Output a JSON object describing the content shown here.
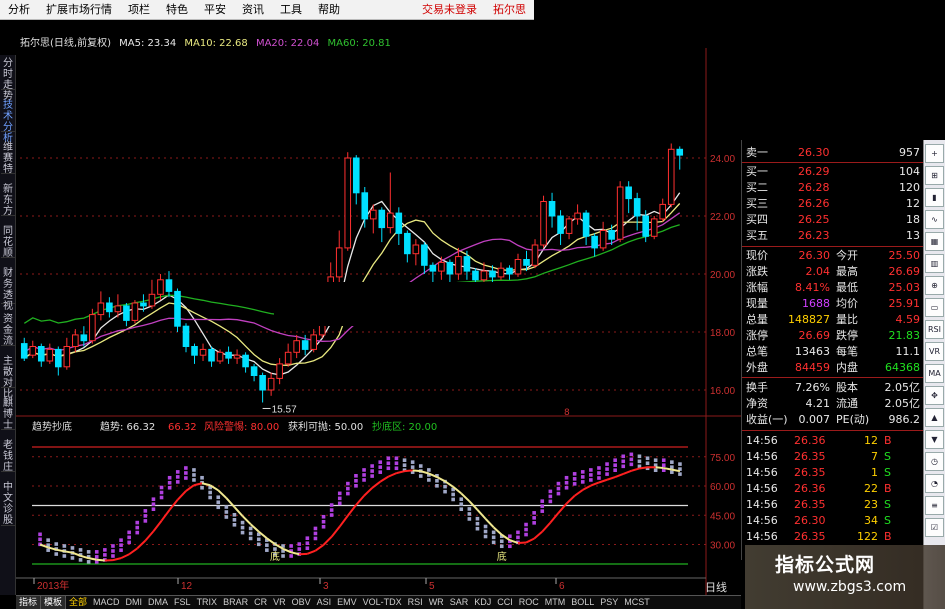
{
  "menu": {
    "items": [
      "分析",
      "扩展市场行情",
      "项栏",
      "特色",
      "平安",
      "资讯",
      "工具",
      "帮助"
    ],
    "login_status": "交易未登录",
    "stock_label": "拓尔思"
  },
  "title": {
    "stock": "拓尔思(日线,前复权)",
    "ma5": "MA5: 23.34",
    "ma10": "MA10: 22.68",
    "ma20": "MA20: 22.04",
    "ma60": "MA60: 20.81"
  },
  "left_tabs": [
    "分时走势",
    "技术分析",
    "维赛特",
    "新东方",
    "同花顺",
    "财务透视",
    "资金流",
    "主散对比",
    "麒博士",
    "老钱庄",
    "中文诊股"
  ],
  "colors": {
    "up": "#ff3030",
    "down": "#00e0ff",
    "ma5": "#e8e8e8",
    "ma10": "#e8e880",
    "ma20": "#c040c0",
    "ma60": "#20b020",
    "grid": "#8b1a1a"
  },
  "chart_data": {
    "type": "candlestick",
    "price_axis": [
      "24.00",
      "22.00",
      "20.00",
      "18.00",
      "16.00"
    ],
    "low_annotation": "15.57",
    "x_labels": [
      "2013年",
      "12",
      "3",
      "5",
      "6"
    ],
    "candles": [
      {
        "o": 17.6,
        "c": 17.1,
        "h": 17.8,
        "l": 17.0
      },
      {
        "o": 17.2,
        "c": 17.5,
        "h": 17.7,
        "l": 17.1
      },
      {
        "o": 17.5,
        "c": 17.0,
        "h": 17.6,
        "l": 16.8
      },
      {
        "o": 17.0,
        "c": 17.4,
        "h": 17.6,
        "l": 16.9
      },
      {
        "o": 17.4,
        "c": 16.8,
        "h": 17.5,
        "l": 16.5
      },
      {
        "o": 16.8,
        "c": 17.5,
        "h": 17.8,
        "l": 16.7
      },
      {
        "o": 17.5,
        "c": 17.9,
        "h": 18.1,
        "l": 17.3
      },
      {
        "o": 17.9,
        "c": 17.7,
        "h": 18.2,
        "l": 17.5
      },
      {
        "o": 17.7,
        "c": 18.6,
        "h": 18.8,
        "l": 17.6
      },
      {
        "o": 18.6,
        "c": 19.0,
        "h": 19.4,
        "l": 18.4
      },
      {
        "o": 19.0,
        "c": 18.7,
        "h": 19.2,
        "l": 18.5
      },
      {
        "o": 18.7,
        "c": 18.9,
        "h": 19.3,
        "l": 18.5
      },
      {
        "o": 18.9,
        "c": 18.4,
        "h": 19.0,
        "l": 18.2
      },
      {
        "o": 18.4,
        "c": 19.0,
        "h": 19.1,
        "l": 18.3
      },
      {
        "o": 19.0,
        "c": 18.9,
        "h": 19.3,
        "l": 18.7
      },
      {
        "o": 18.9,
        "c": 19.3,
        "h": 19.8,
        "l": 18.8
      },
      {
        "o": 19.3,
        "c": 19.8,
        "h": 20.0,
        "l": 19.1
      },
      {
        "o": 19.8,
        "c": 19.4,
        "h": 20.1,
        "l": 19.2
      },
      {
        "o": 19.4,
        "c": 18.2,
        "h": 19.5,
        "l": 18.0
      },
      {
        "o": 18.2,
        "c": 17.5,
        "h": 18.3,
        "l": 17.3
      },
      {
        "o": 17.5,
        "c": 17.2,
        "h": 17.6,
        "l": 16.9
      },
      {
        "o": 17.2,
        "c": 17.4,
        "h": 17.6,
        "l": 17.0
      },
      {
        "o": 17.4,
        "c": 17.0,
        "h": 17.5,
        "l": 16.8
      },
      {
        "o": 17.0,
        "c": 17.3,
        "h": 17.4,
        "l": 16.9
      },
      {
        "o": 17.3,
        "c": 17.1,
        "h": 17.5,
        "l": 16.9
      },
      {
        "o": 17.1,
        "c": 17.2,
        "h": 17.4,
        "l": 16.9
      },
      {
        "o": 17.2,
        "c": 16.8,
        "h": 17.3,
        "l": 16.6
      },
      {
        "o": 16.8,
        "c": 16.5,
        "h": 16.9,
        "l": 16.3
      },
      {
        "o": 16.5,
        "c": 16.0,
        "h": 16.6,
        "l": 15.57
      },
      {
        "o": 16.0,
        "c": 16.4,
        "h": 16.6,
        "l": 15.8
      },
      {
        "o": 16.4,
        "c": 16.9,
        "h": 17.1,
        "l": 16.2
      },
      {
        "o": 16.9,
        "c": 17.3,
        "h": 17.6,
        "l": 16.8
      },
      {
        "o": 17.3,
        "c": 17.7,
        "h": 17.9,
        "l": 17.1
      },
      {
        "o": 17.7,
        "c": 17.4,
        "h": 17.9,
        "l": 17.2
      },
      {
        "o": 17.4,
        "c": 17.9,
        "h": 18.1,
        "l": 17.3
      },
      {
        "o": 17.9,
        "c": 18.6,
        "h": 18.8,
        "l": 17.8
      },
      {
        "o": 18.6,
        "c": 19.9,
        "h": 20.4,
        "l": 18.5
      },
      {
        "o": 19.9,
        "c": 20.9,
        "h": 21.5,
        "l": 19.7
      },
      {
        "o": 20.9,
        "c": 24.0,
        "h": 24.2,
        "l": 20.8
      },
      {
        "o": 24.0,
        "c": 22.8,
        "h": 24.1,
        "l": 22.4
      },
      {
        "o": 22.8,
        "c": 21.9,
        "h": 23.0,
        "l": 21.6
      },
      {
        "o": 21.9,
        "c": 22.2,
        "h": 22.4,
        "l": 21.4
      },
      {
        "o": 22.2,
        "c": 21.6,
        "h": 22.3,
        "l": 21.1
      },
      {
        "o": 21.6,
        "c": 22.1,
        "h": 23.5,
        "l": 21.4
      },
      {
        "o": 22.1,
        "c": 21.4,
        "h": 22.3,
        "l": 21.0
      },
      {
        "o": 21.4,
        "c": 20.7,
        "h": 21.5,
        "l": 20.4
      },
      {
        "o": 20.7,
        "c": 21.0,
        "h": 21.2,
        "l": 20.3
      },
      {
        "o": 21.0,
        "c": 20.3,
        "h": 21.1,
        "l": 20.0
      },
      {
        "o": 20.3,
        "c": 20.1,
        "h": 20.4,
        "l": 19.7
      },
      {
        "o": 20.1,
        "c": 20.4,
        "h": 20.6,
        "l": 19.8
      },
      {
        "o": 20.4,
        "c": 20.0,
        "h": 20.5,
        "l": 19.6
      },
      {
        "o": 20.0,
        "c": 20.6,
        "h": 20.9,
        "l": 19.8
      },
      {
        "o": 20.6,
        "c": 20.1,
        "h": 20.8,
        "l": 19.8
      },
      {
        "o": 20.1,
        "c": 19.8,
        "h": 20.2,
        "l": 19.5
      },
      {
        "o": 19.8,
        "c": 20.1,
        "h": 20.4,
        "l": 19.6
      },
      {
        "o": 20.1,
        "c": 19.9,
        "h": 20.3,
        "l": 19.7
      },
      {
        "o": 19.9,
        "c": 20.2,
        "h": 20.4,
        "l": 19.8
      },
      {
        "o": 20.2,
        "c": 20.0,
        "h": 20.3,
        "l": 19.8
      },
      {
        "o": 20.0,
        "c": 20.5,
        "h": 20.7,
        "l": 19.9
      },
      {
        "o": 20.5,
        "c": 20.3,
        "h": 20.8,
        "l": 20.1
      },
      {
        "o": 20.3,
        "c": 21.0,
        "h": 21.2,
        "l": 20.2
      },
      {
        "o": 21.0,
        "c": 22.5,
        "h": 22.7,
        "l": 20.9
      },
      {
        "o": 22.5,
        "c": 22.0,
        "h": 22.8,
        "l": 21.6
      },
      {
        "o": 22.0,
        "c": 21.4,
        "h": 22.2,
        "l": 21.0
      },
      {
        "o": 21.4,
        "c": 21.9,
        "h": 22.0,
        "l": 21.2
      },
      {
        "o": 21.9,
        "c": 22.1,
        "h": 22.4,
        "l": 21.7
      },
      {
        "o": 22.1,
        "c": 21.3,
        "h": 22.2,
        "l": 21.0
      },
      {
        "o": 21.3,
        "c": 20.9,
        "h": 21.4,
        "l": 20.6
      },
      {
        "o": 20.9,
        "c": 21.5,
        "h": 21.8,
        "l": 20.8
      },
      {
        "o": 21.5,
        "c": 21.2,
        "h": 21.7,
        "l": 21.0
      },
      {
        "o": 21.2,
        "c": 23.0,
        "h": 23.2,
        "l": 21.1
      },
      {
        "o": 23.0,
        "c": 22.6,
        "h": 23.2,
        "l": 22.1
      },
      {
        "o": 22.6,
        "c": 22.0,
        "h": 22.8,
        "l": 21.5
      },
      {
        "o": 22.0,
        "c": 21.3,
        "h": 22.2,
        "l": 21.1
      },
      {
        "o": 21.3,
        "c": 21.9,
        "h": 22.0,
        "l": 21.2
      },
      {
        "o": 21.9,
        "c": 22.4,
        "h": 22.6,
        "l": 21.8
      },
      {
        "o": 22.4,
        "c": 24.3,
        "h": 24.5,
        "l": 22.3
      },
      {
        "o": 24.3,
        "c": 24.1,
        "h": 24.4,
        "l": 23.6
      }
    ],
    "lower_title": "趋势抄底",
    "trend_label": "趋势: 66.32",
    "trend_value": "66.32",
    "risk_label": "风险警惕: 80.00",
    "profit_label": "获利可抛: 50.00",
    "bottom_zone_label": "抄底区: 20.00",
    "lower_axis": [
      "75.00",
      "60.00",
      "45.00",
      "30.00"
    ],
    "bottom_marks": [
      "底",
      "底"
    ],
    "trend_series": [
      30,
      27,
      25,
      24,
      23,
      22,
      21,
      21,
      22,
      24,
      27,
      31,
      36,
      42,
      48,
      54,
      59,
      62,
      64,
      63,
      59,
      54,
      49,
      44,
      40,
      36,
      33,
      30,
      27,
      25,
      24,
      24,
      25,
      28,
      33,
      39,
      45,
      51,
      56,
      60,
      63,
      65,
      67,
      69,
      69,
      68,
      67,
      65,
      63,
      60,
      57,
      53,
      48,
      43,
      38,
      34,
      31,
      29,
      29,
      31,
      35,
      41,
      47,
      52,
      56,
      59,
      61,
      62,
      63,
      64,
      66,
      68,
      70,
      71,
      70,
      69,
      68,
      68,
      67,
      66
    ]
  },
  "quote": {
    "sell1": [
      "卖一",
      "26.30",
      "957"
    ],
    "buys": [
      [
        "买一",
        "26.29",
        "104"
      ],
      [
        "买二",
        "26.28",
        "120"
      ],
      [
        "买三",
        "26.26",
        "12"
      ],
      [
        "买四",
        "26.25",
        "18"
      ],
      [
        "买五",
        "26.23",
        "13"
      ]
    ],
    "stats": [
      [
        "现价",
        "26.30",
        "今开",
        "25.50"
      ],
      [
        "涨跌",
        "2.04",
        "最高",
        "26.69"
      ],
      [
        "涨幅",
        "8.41%",
        "最低",
        "25.03"
      ],
      [
        "现量",
        "1688",
        "均价",
        "25.91"
      ],
      [
        "总量",
        "148827",
        "量比",
        "4.59"
      ],
      [
        "涨停",
        "26.69",
        "跌停",
        "21.83"
      ],
      [
        "总笔",
        "13463",
        "每笔",
        "11.1"
      ],
      [
        "外盘",
        "84459",
        "内盘",
        "64368"
      ]
    ],
    "stats2": [
      [
        "换手",
        "7.26%",
        "股本",
        "2.05亿"
      ],
      [
        "净资",
        "4.21",
        "流通",
        "2.05亿"
      ],
      [
        "收益(一)",
        "0.007",
        "PE(动)",
        "986.2"
      ]
    ],
    "ticks": [
      [
        "14:56",
        "26.36",
        "12",
        "B"
      ],
      [
        "14:56",
        "26.35",
        "7",
        "S"
      ],
      [
        "14:56",
        "26.35",
        "1",
        "S"
      ],
      [
        "14:56",
        "26.36",
        "22",
        "B"
      ],
      [
        "14:56",
        "26.35",
        "23",
        "S"
      ],
      [
        "14:56",
        "26.30",
        "34",
        "S"
      ],
      [
        "14:56",
        "26.35",
        "122",
        "B"
      ]
    ]
  },
  "right_icons": [
    "RSI",
    "VR",
    "MA"
  ],
  "bottom_tabs": [
    "指标",
    "模板",
    "全部",
    "MACD",
    "DMI",
    "DMA",
    "FSL",
    "TRIX",
    "BRAR",
    "CR",
    "VR",
    "OBV",
    "ASI",
    "EMV",
    "VOL-TDX",
    "RSI",
    "WR",
    "SAR",
    "KDJ",
    "CCI",
    "ROC",
    "MTM",
    "BOLL",
    "PSY",
    "MCST"
  ],
  "period_label": "日线",
  "watermark": {
    "title": "指标公式网",
    "url": "www.zbgs3.com"
  }
}
